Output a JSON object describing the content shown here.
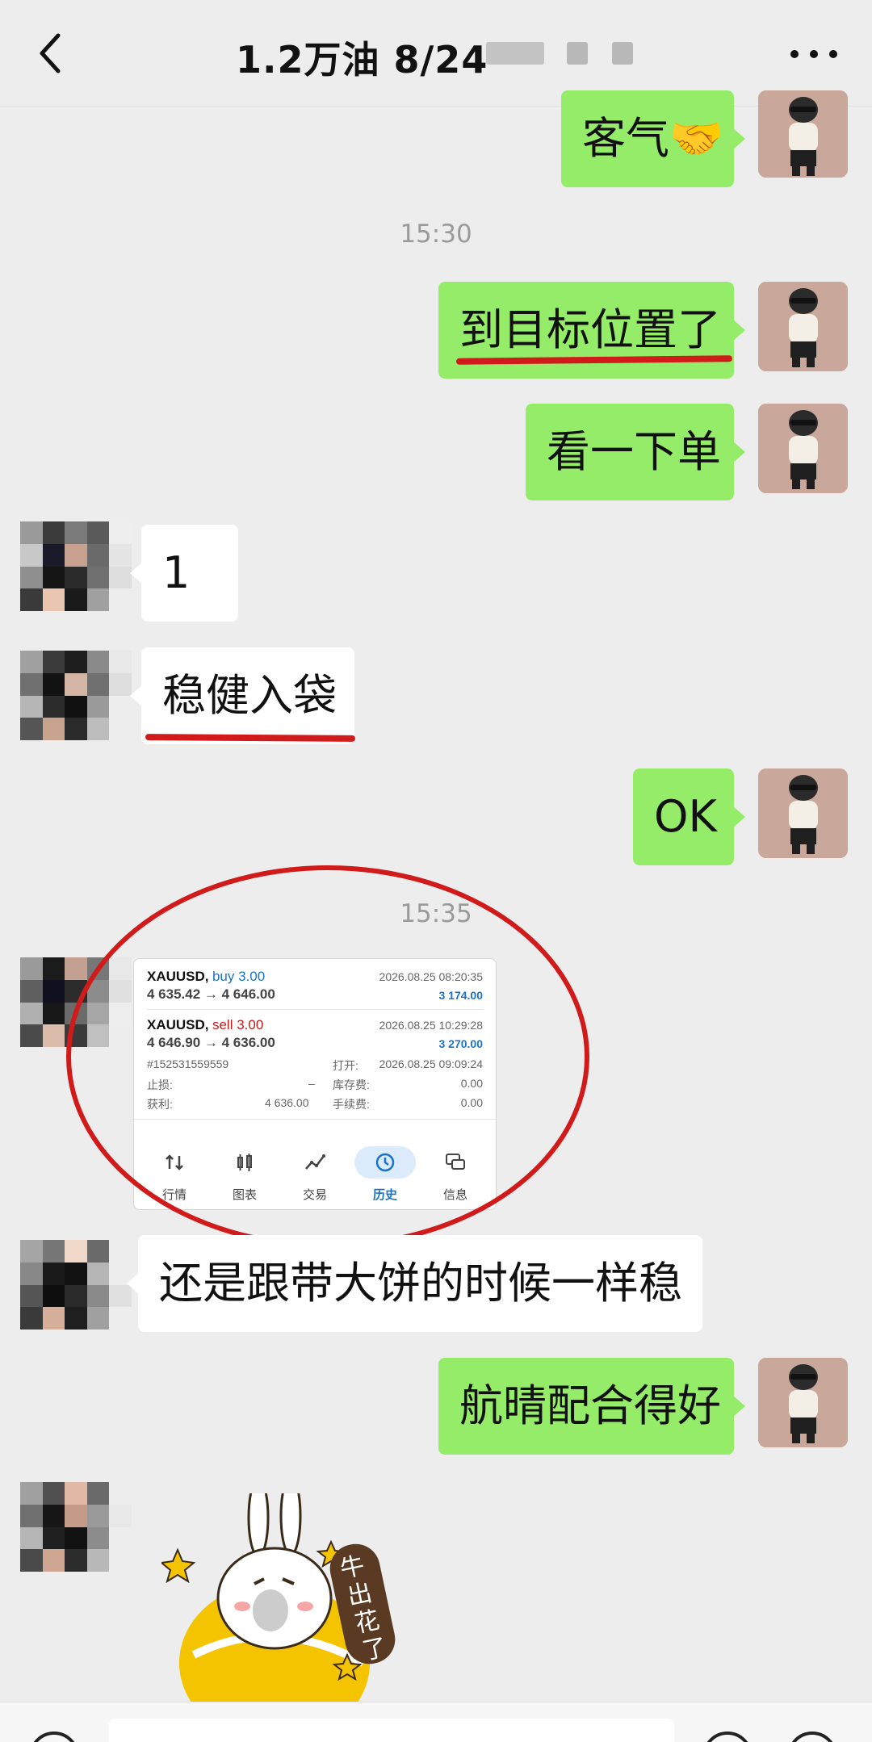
{
  "header": {
    "title": "1.2万油  8/24"
  },
  "messages": {
    "m1": "客气🤝",
    "ts1": "15:30",
    "m2": "到目标位置了",
    "m3": "看一下单",
    "m4": "1",
    "m5": "稳健入袋",
    "m6": "OK",
    "ts2": "15:35",
    "m7": "还是跟带大饼的时候一样稳",
    "m8": "航晴配合得好"
  },
  "trade_card": {
    "t1": {
      "symbol": "XAUUSD,",
      "side": "buy 3.00",
      "prices": "4 635.42 → 4 646.00",
      "date": "2026.08.25 08:20:35",
      "profit": "3 174.00"
    },
    "t2": {
      "symbol": "XAUUSD,",
      "side": "sell 3.00",
      "prices": "4 646.90 → 4 636.00",
      "date": "2026.08.25 10:29:28",
      "profit": "3 270.00"
    },
    "order_id": "#152531559559",
    "open_label": "打开:",
    "open_time": "2026.08.25 09:09:24",
    "sl_label": "止损:",
    "sl_value": "–",
    "swap_label": "库存费:",
    "swap_value": "0.00",
    "tp_label": "获利:",
    "tp_value": "4 636.00",
    "fee_label": "手续费:",
    "fee_value": "0.00",
    "nav": [
      "行情",
      "图表",
      "交易",
      "历史",
      "信息"
    ]
  },
  "sticker": {
    "text": "牛出花了"
  },
  "colors": {
    "my_bubble": "#95ec69",
    "their_bubble": "#ffffff",
    "annotation_red": "#d11a1a",
    "background": "#ededed"
  }
}
